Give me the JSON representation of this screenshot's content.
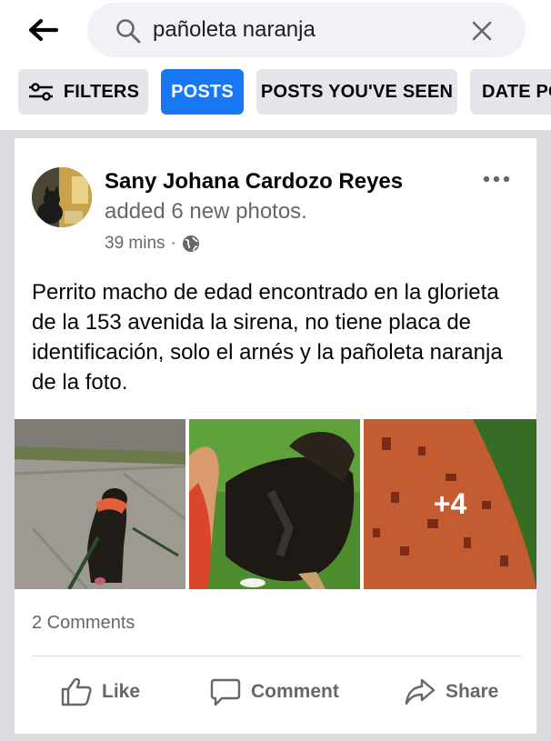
{
  "search": {
    "value": "pañoleta naranja"
  },
  "filters": {
    "filters_label": "FILTERS",
    "posts_label": "POSTS",
    "seen_label": "POSTS YOU'VE SEEN",
    "date_label": "DATE POSTED"
  },
  "post": {
    "author": "Sany Johana Cardozo Reyes",
    "action": "added 6 new photos.",
    "time": "39 mins",
    "dot": "·",
    "audience_icon": "globe-icon",
    "text": "Perrito macho de edad encontrado en la glorieta de la 153 avenida la sirena, no tiene placa de identificación, solo el arnés y la pañoleta naranja de la foto.",
    "more_photos": "+4",
    "comments": "2 Comments",
    "like_label": "Like",
    "comment_label": "Comment",
    "share_label": "Share"
  },
  "colors": {
    "accent": "#1877f2",
    "chip": "#e4e6eb",
    "secondary_text": "#65676b"
  }
}
